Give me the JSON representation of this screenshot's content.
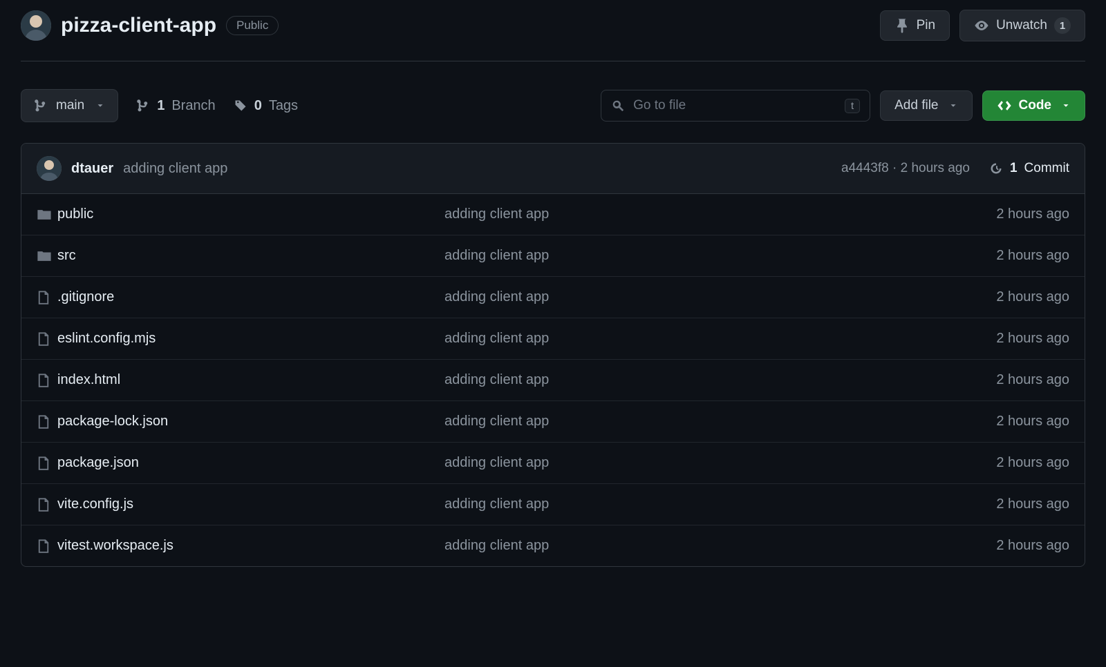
{
  "repo": {
    "name": "pizza-client-app",
    "visibility": "Public"
  },
  "headerActions": {
    "pin": "Pin",
    "unwatch": "Unwatch",
    "unwatchCount": "1"
  },
  "branch": {
    "current": "main",
    "branchCount": "1",
    "branchLabel": "Branch",
    "tagCount": "0",
    "tagLabel": "Tags"
  },
  "search": {
    "placeholder": "Go to file",
    "kbd": "t"
  },
  "actions": {
    "addFile": "Add file",
    "code": "Code"
  },
  "latestCommit": {
    "author": "dtauer",
    "message": "adding client app",
    "sha": "a4443f8",
    "sep": "·",
    "time": "2 hours ago",
    "countNum": "1",
    "countLabel": "Commit"
  },
  "files": [
    {
      "type": "dir",
      "name": "public",
      "msg": "adding client app",
      "time": "2 hours ago"
    },
    {
      "type": "dir",
      "name": "src",
      "msg": "adding client app",
      "time": "2 hours ago"
    },
    {
      "type": "file",
      "name": ".gitignore",
      "msg": "adding client app",
      "time": "2 hours ago"
    },
    {
      "type": "file",
      "name": "eslint.config.mjs",
      "msg": "adding client app",
      "time": "2 hours ago"
    },
    {
      "type": "file",
      "name": "index.html",
      "msg": "adding client app",
      "time": "2 hours ago"
    },
    {
      "type": "file",
      "name": "package-lock.json",
      "msg": "adding client app",
      "time": "2 hours ago"
    },
    {
      "type": "file",
      "name": "package.json",
      "msg": "adding client app",
      "time": "2 hours ago"
    },
    {
      "type": "file",
      "name": "vite.config.js",
      "msg": "adding client app",
      "time": "2 hours ago"
    },
    {
      "type": "file",
      "name": "vitest.workspace.js",
      "msg": "adding client app",
      "time": "2 hours ago"
    }
  ]
}
